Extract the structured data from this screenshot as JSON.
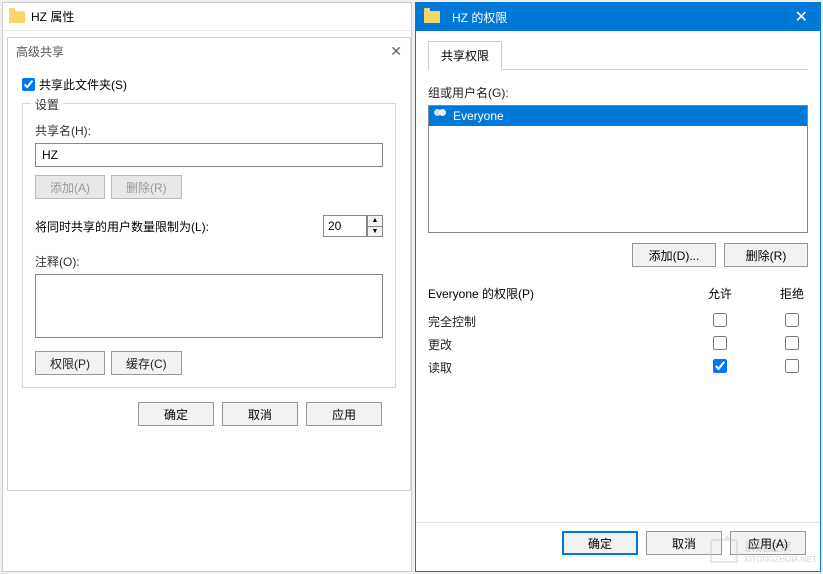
{
  "props": {
    "title": "HZ 属性"
  },
  "adv": {
    "title": "高级共享",
    "share_checkbox_label": "共享此文件夹(S)",
    "share_checked": true,
    "settings_label": "设置",
    "share_name_label": "共享名(H):",
    "share_name_value": "HZ",
    "add_btn": "添加(A)",
    "remove_btn": "删除(R)",
    "limit_label": "将同时共享的用户数量限制为(L):",
    "limit_value": "20",
    "comment_label": "注释(O):",
    "comment_value": "",
    "perm_btn": "权限(P)",
    "cache_btn": "缓存(C)",
    "ok_btn": "确定",
    "cancel_btn": "取消",
    "apply_btn": "应用"
  },
  "perm": {
    "title": "HZ 的权限",
    "tab_label": "共享权限",
    "groups_label": "组或用户名(G):",
    "users": [
      {
        "name": "Everyone",
        "selected": true
      }
    ],
    "add_btn": "添加(D)...",
    "remove_btn": "删除(R)",
    "permissions_for_label": "Everyone 的权限(P)",
    "allow_label": "允许",
    "deny_label": "拒绝",
    "rows": [
      {
        "label": "完全控制",
        "allow": false,
        "deny": false
      },
      {
        "label": "更改",
        "allow": false,
        "deny": false
      },
      {
        "label": "读取",
        "allow": true,
        "deny": false
      }
    ],
    "ok_btn": "确定",
    "cancel_btn": "取消",
    "apply_btn": "应用(A)"
  },
  "watermark": {
    "text1": "系统之家",
    "text2": "XITONGZHIJIA.NET"
  }
}
